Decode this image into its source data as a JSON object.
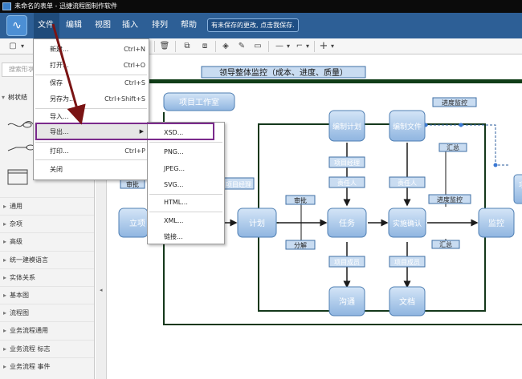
{
  "window": {
    "title": "未命名的表单 - 迅捷流程图制作软件"
  },
  "menubar": {
    "logo_glyph": "∿",
    "items": [
      "文件",
      "编辑",
      "视图",
      "插入",
      "排列",
      "帮助"
    ],
    "save_status": "有未保存的更改, 点击我保存."
  },
  "toolbar": {
    "glyphs": {
      "page": "▢",
      "dropdown": "▾",
      "delete": "🗑",
      "front": "⧉",
      "back": "⧈",
      "fill": "◈",
      "line": "✎",
      "shadow": "▭",
      "connector": "—",
      "waypoints": "⌐",
      "plus": "+"
    }
  },
  "sidebar": {
    "search_placeholder": "搜索形状",
    "shape_header": "树状结",
    "categories": [
      "通用",
      "杂项",
      "高级",
      "统一建模语言",
      "实体关系",
      "基本图",
      "流程图",
      "业务流程通用",
      "业务流程 标志",
      "业务流程 事件"
    ]
  },
  "file_menu": {
    "items": [
      {
        "label": "新建...",
        "shortcut": "Ctrl+N"
      },
      {
        "label": "打开...",
        "shortcut": "Ctrl+O"
      },
      {
        "label": "保存",
        "shortcut": "Ctrl+S"
      },
      {
        "label": "另存为...",
        "shortcut": "Ctrl+Shift+S"
      },
      {
        "label": "导入...",
        "shortcut": ""
      },
      {
        "label": "导出...",
        "shortcut": ""
      },
      {
        "label": "打印...",
        "shortcut": "Ctrl+P"
      },
      {
        "label": "关闭",
        "shortcut": ""
      }
    ]
  },
  "export_menu": {
    "items": [
      "XSD...",
      "PNG...",
      "JPEG...",
      "SVG...",
      "HTML...",
      "XML...",
      "链接..."
    ]
  },
  "diagram": {
    "title": "领导整体监控（成本、进度、质量）",
    "project_work": "项目工作室",
    "nodes": {
      "lixiang": "立项",
      "jihua": "计划",
      "renwu": "任务",
      "shenqian": "实施确认",
      "jiankong": "监控",
      "bianzhi_jihua": "编制计划",
      "bianzhi_wenjian": "编制文件",
      "goutong": "沟通",
      "wendang": "文档"
    },
    "labels": {
      "shenpi1": "审批",
      "xiangmu_jingli_l": "项目经理",
      "shenpi2": "审批",
      "fenjie": "分解",
      "xiangmu_jingli": "项目经理",
      "zeren_ren1": "责任人",
      "zeren_ren2": "责任人",
      "jindu_jiankong1": "进度监控",
      "huizong1": "汇总",
      "jindu_jiankong2": "进度监控",
      "huizong2": "汇总",
      "xiangmu_chengyuan1": "项目成员",
      "xiangmu_chengyuan2": "项目成员",
      "right_edge": "项"
    }
  },
  "colors": {
    "menubar": "#2d5f96",
    "node_fill": "#a9c8ea",
    "node_border": "#4f7fb3",
    "highlight": "#7b2a8c",
    "annotation_arrow": "#7a1414"
  }
}
